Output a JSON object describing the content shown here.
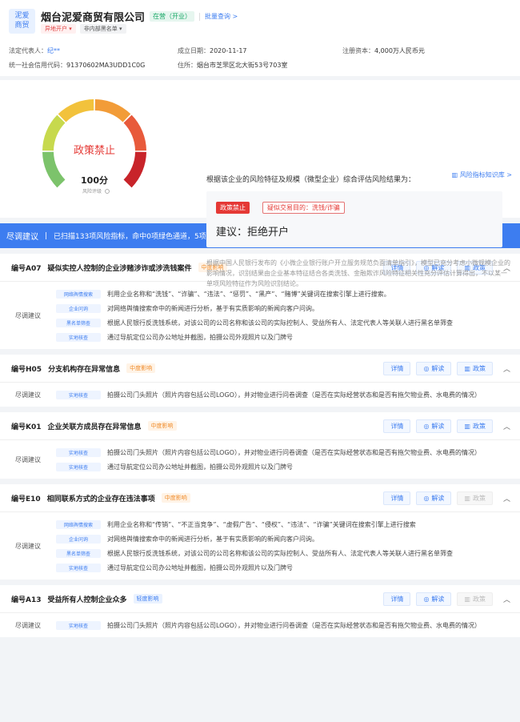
{
  "header": {
    "logo_text": "泥爱\n商贸",
    "company": "烟台泥爱商贸有限公司",
    "status": "在营（开业）",
    "batch": "批量查询 >",
    "tag_remote": "异地开户",
    "tag_blacklist": "非内部黑名单",
    "legal_label": "法定代表人：",
    "legal_value": "纪**",
    "est_label": "成立日期：",
    "est_value": "2020-11-17",
    "cap_label": "注册资本：",
    "cap_value": "4,000万人民币元",
    "ucc_label": "统一社会信用代码：",
    "ucc_value": "91370602MA3UDD1C0G",
    "addr_label": "住所：",
    "addr_value": "烟台市芝罘区北大街53号703室"
  },
  "risk": {
    "gauge_text": "政策禁止",
    "score": "100分",
    "score_sub": "风险评级",
    "score_value": 100,
    "title": "根据该企业的风险特征及规模（微型企业）综合评估风险结果为：",
    "kb": "风险指标知识库 >",
    "tag1": "政策禁止",
    "tag2": "疑似交易目的：洗钱/诈骗",
    "advice": "建议：拒绝开户",
    "desc": "根据中国人民银行发布的《小微企业银行账户开立服务规范负面清单指引》，模型已充分考虑小微规模企业的影响情况，识别结果由企业基本特征结合各类洗钱、金融欺诈风险特征相关性充分评估计算得出，不以某一单项风险特征作为风险识别结论。"
  },
  "banner": {
    "title": "尽调建议",
    "text": "已扫描133项风险指标，命中0项绿色通道，5项重度指标，9项中度指标，12项轻度指标，企百科为您提供了12项尽职调查建议："
  },
  "labels": {
    "detail": "详情",
    "explain": "解读",
    "policy": "政策",
    "suggest": "尽调建议"
  },
  "items": [
    {
      "code": "编号A07",
      "title": "疑似实控人控制的企业涉赌涉诈或涉洗钱案件",
      "level": "中度影响",
      "lvl": "mid",
      "policy_enabled": true,
      "rows": [
        {
          "src": "网络舆情搜索",
          "text": "利用企业名称和“洗钱”、“诈骗”、“违法”、“惩罚”、“黑产”、“赌博”关键词在搜索引擎上进行搜索。"
        },
        {
          "src": "企业问询",
          "text": "对网络舆情搜索命中的新闻进行分析，基于有实质影响的新闻向客户问询。"
        },
        {
          "src": "黑名单筛查",
          "text": "根据人民银行反洗钱系统，对该公司的公司名称和该公司的实际控制人、受益所有人、法定代表人等关联人进行黑名单筛查"
        },
        {
          "src": "实地核查",
          "text": "通过导航定位公司办公地址并截图，拍摄公司外观照片以及门牌号"
        }
      ]
    },
    {
      "code": "编号H05",
      "title": "分支机构存在异常信息",
      "level": "中度影响",
      "lvl": "mid",
      "policy_enabled": true,
      "rows": [
        {
          "src": "实地核查",
          "text": "拍摄公司门头照片（照片内容包括公司LOGO），并对物业进行问卷调查（是否在实际经营状态和是否有拖欠物业费、水电费的情况）"
        }
      ]
    },
    {
      "code": "编号K01",
      "title": "企业关联方成员存在异常信息",
      "level": "中度影响",
      "lvl": "mid",
      "policy_enabled": true,
      "rows": [
        {
          "src": "实地核查",
          "text": "拍摄公司门头照片（照片内容包括公司LOGO），并对物业进行问卷调查（是否在实际经营状态和是否有拖欠物业费、水电费的情况）"
        },
        {
          "src": "实地核查",
          "text": "通过导航定位公司办公地址并截图，拍摄公司外观照片以及门牌号"
        }
      ]
    },
    {
      "code": "编号E10",
      "title": "相同联系方式的企业存在违法事项",
      "level": "中度影响",
      "lvl": "mid",
      "policy_enabled": false,
      "rows": [
        {
          "src": "网络舆情搜索",
          "text": "利用企业名称和“传销”、“不正当竞争”、“虚假广告”、“侵权”、“违法”、“诈骗”关键词在搜索引擎上进行搜索"
        },
        {
          "src": "企业问询",
          "text": "对网络舆情搜索命中的新闻进行分析，基于有实质影响的新闻向客户问询。"
        },
        {
          "src": "黑名单筛查",
          "text": "根据人民银行反洗钱系统，对该公司的公司名称和该公司的实际控制人、受益所有人、法定代表人等关联人进行黑名单筛查"
        },
        {
          "src": "实地核查",
          "text": "通过导航定位公司办公地址并截图，拍摄公司外观照片以及门牌号"
        }
      ]
    },
    {
      "code": "编号A13",
      "title": "受益所有人控制企业众多",
      "level": "轻度影响",
      "lvl": "low",
      "policy_enabled": false,
      "rows": [
        {
          "src": "实地核查",
          "text": "拍摄公司门头照片（照片内容包括公司LOGO），并对物业进行问卷调查（是否在实际经营状态和是否有拖欠物业费、水电费的情况）"
        }
      ]
    }
  ],
  "colors": {
    "accent": "#3d7df0",
    "danger": "#e53935",
    "gauge": [
      "#7cc36b",
      "#c7d94d",
      "#f2c23c",
      "#f29c38",
      "#e85a3b",
      "#c8242a"
    ]
  }
}
